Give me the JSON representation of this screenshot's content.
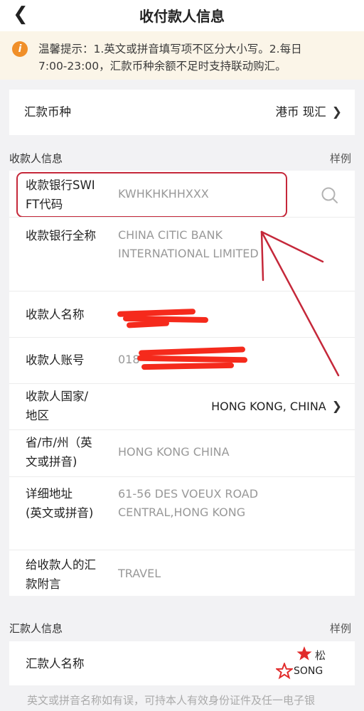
{
  "nav": {
    "back_icon": "chevron-left-icon",
    "title": "收付款人信息"
  },
  "notice": {
    "icon": "info-icon",
    "icon_glyph": "i",
    "line1": "温馨提示：1.英文或拼音填写项不区分大小写。2.每日",
    "line2": "7:00-23:00，汇款币种余额不足时支持联动购汇。"
  },
  "currency": {
    "label": "汇款币种",
    "value": "港币 现汇"
  },
  "payee_section": {
    "title": "收款人信息",
    "example": "样例",
    "swift": {
      "label_line1": "收款银行SWI",
      "label_line2": "FT代码",
      "value": "KWHKHKHHXXX"
    },
    "bank_name": {
      "label": "收款银行全称",
      "value_line1": "CHINA CITIC BANK",
      "value_line2": "INTERNATIONAL LIMITED"
    },
    "payee_name": {
      "label": "收款人名称",
      "value": ""
    },
    "account": {
      "label": "收款人账号",
      "value": "018"
    },
    "country": {
      "label_line1": "收款人国家/",
      "label_line2": "地区",
      "value": "HONG KONG, CHINA"
    },
    "province": {
      "label_line1": "省/市/州（英",
      "label_line2": "文或拼音)",
      "value": "HONG KONG CHINA"
    },
    "address": {
      "label_line1": "详细地址",
      "label_line2": "(英文或拼音)",
      "value_line1": "61-56 DES VOEUX ROAD",
      "value_line2": "CENTRAL,HONG KONG"
    },
    "remark": {
      "label_line1": "给收款人的汇",
      "label_line2": "款附言",
      "value": "TRAVEL"
    }
  },
  "remitter_section": {
    "title": "汇款人信息",
    "example": "样例",
    "name": {
      "label": "汇款人名称",
      "value_cn": "松",
      "value_en": "SONG"
    }
  },
  "hint": "英文或拼音名称如有误，可持本人有效身份证件及任一电子银",
  "colors": {
    "highlight": "#c5283a",
    "scribble": "#f52a1c",
    "notice_bg": "#fbf5e8",
    "notice_icon": "#f08f29"
  }
}
